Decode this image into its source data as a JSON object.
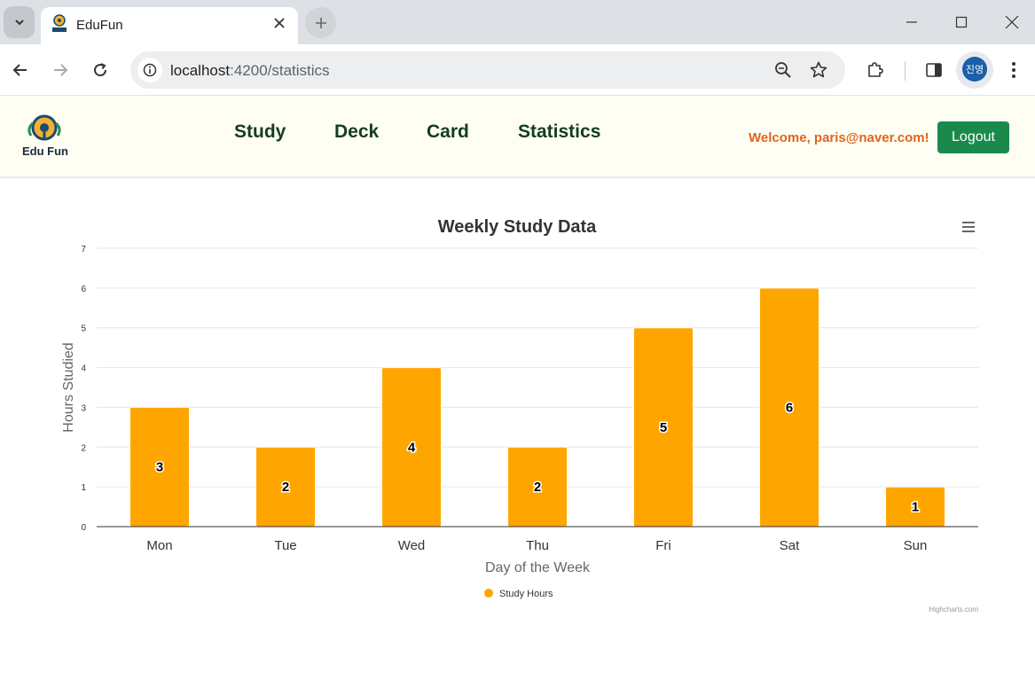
{
  "browser": {
    "tab_title": "EduFun",
    "url_host": "localhost",
    "url_path": ":4200/statistics",
    "profile_initials": "진영"
  },
  "app": {
    "logo_text": "Edu Fun",
    "nav": [
      {
        "label": "Study"
      },
      {
        "label": "Deck"
      },
      {
        "label": "Card"
      },
      {
        "label": "Statistics"
      }
    ],
    "welcome": "Welcome,  paris@naver.com!",
    "logout_label": "Logout"
  },
  "colors": {
    "bar": "#ffa500",
    "header_bg": "#fefef2",
    "nav_text": "#143d1f",
    "welcome_text": "#e0641c",
    "logout_bg": "#1a8a4c"
  },
  "chart_data": {
    "type": "bar",
    "title": "Weekly Study Data",
    "categories": [
      "Mon",
      "Tue",
      "Wed",
      "Thu",
      "Fri",
      "Sat",
      "Sun"
    ],
    "series": [
      {
        "name": "Study Hours",
        "values": [
          3,
          2,
          4,
          2,
          5,
          6,
          1
        ],
        "color": "#ffa500"
      }
    ],
    "xlabel": "Day of the Week",
    "ylabel": "Hours Studied",
    "ylim": [
      0,
      7
    ],
    "yticks": [
      0,
      1,
      2,
      3,
      4,
      5,
      6,
      7
    ],
    "grid": true,
    "data_labels": true,
    "legend": "bottom-center",
    "credit": "Highcharts.com"
  }
}
